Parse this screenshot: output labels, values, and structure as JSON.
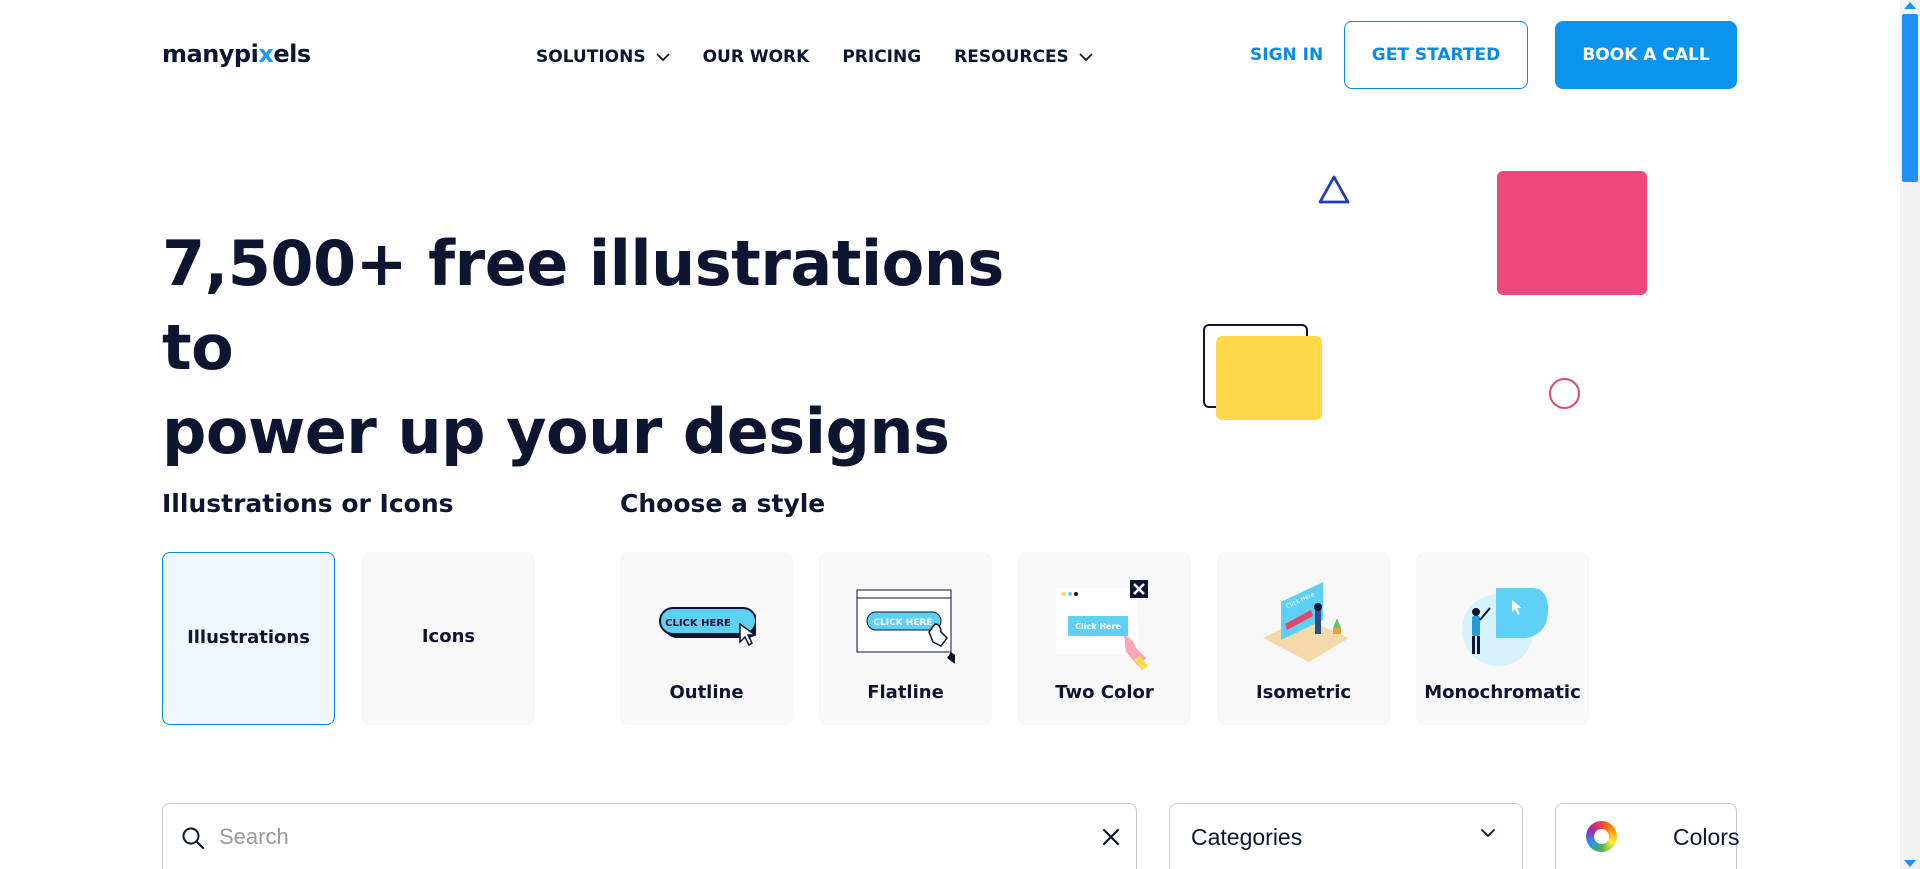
{
  "header": {
    "logo_text_a": "manypi",
    "logo_text_dot": "x",
    "logo_text_b": "els",
    "nav": [
      {
        "label": "SOLUTIONS",
        "has_dropdown": true
      },
      {
        "label": "OUR WORK",
        "has_dropdown": false
      },
      {
        "label": "PRICING",
        "has_dropdown": false
      },
      {
        "label": "RESOURCES",
        "has_dropdown": true
      }
    ],
    "sign_in": "SIGN IN",
    "get_started": "GET STARTED",
    "book_call": "BOOK A CALL"
  },
  "hero": {
    "title_line1": "7,500+ free illustrations to",
    "title_line2": "power up your designs"
  },
  "type_section": {
    "label": "Illustrations or Icons",
    "options": [
      {
        "label": "Illustrations",
        "selected": true
      },
      {
        "label": "Icons",
        "selected": false
      }
    ]
  },
  "style_section": {
    "label": "Choose a style",
    "options": [
      {
        "label": "Outline",
        "art_text": "CLICK HERE"
      },
      {
        "label": "Flatline",
        "art_text": "CLICK HERE"
      },
      {
        "label": "Two Color",
        "art_text": "Click Here"
      },
      {
        "label": "Isometric",
        "art_text": "Click Here"
      },
      {
        "label": "Monochromatic"
      }
    ]
  },
  "filters": {
    "search_placeholder": "Search",
    "categories_label": "Categories",
    "colors_label": "Colors"
  },
  "colors": {
    "accent": "#0a94ee",
    "pink": "#f0477c",
    "yellow": "#ffd84b",
    "navy": "#0d1530"
  },
  "icons": [
    "chevron-down-icon",
    "search-icon",
    "close-icon",
    "color-wheel-icon",
    "triangle-shape",
    "circle-shape"
  ]
}
